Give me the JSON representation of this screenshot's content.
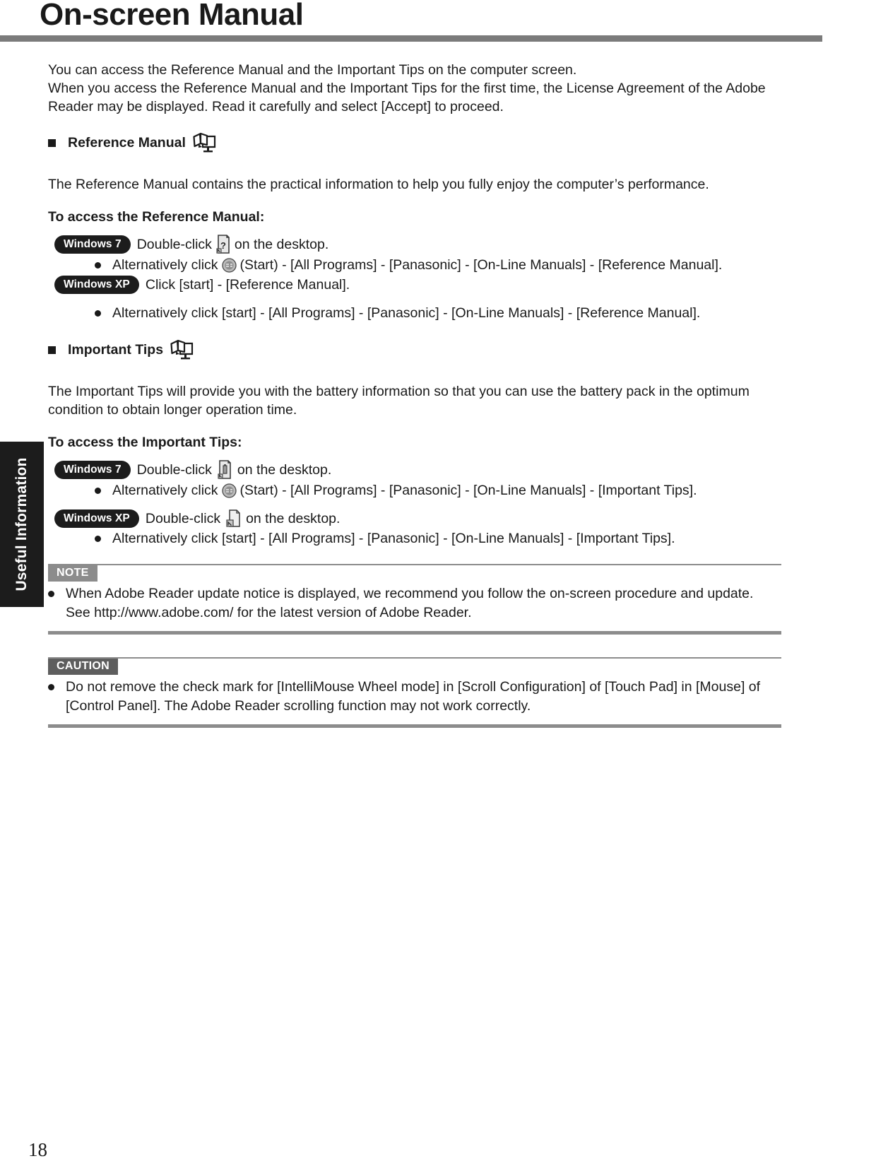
{
  "header": {
    "title": "On-screen Manual"
  },
  "side_tab": {
    "label": "Useful Information"
  },
  "intro": {
    "line1": "You can access the Reference Manual and the Important Tips on the computer screen.",
    "line2": "When you access the Reference Manual and the Important Tips for the first time, the License Agreement of the Adobe",
    "line3": "Reader may be displayed. Read it carefully and select [Accept] to proceed."
  },
  "reference_manual": {
    "heading": "Reference Manual",
    "heading_icon": "book-monitor-icon",
    "description": "The Reference Manual contains the practical information to help you fully enjoy the computer’s performance.",
    "access_heading": "To access the Reference Manual:",
    "win7_badge": "Windows 7",
    "win7_text_before": "Double-click",
    "win7_icon": "document-question-icon",
    "win7_text_after": "on the desktop.",
    "win7_alt_before": "Alternatively click",
    "win7_alt_icon": "start-orb-icon",
    "win7_alt_after": "(Start) - [All Programs] - [Panasonic] - [On-Line Manuals] - [Reference Manual].",
    "winxp_badge": "Windows XP",
    "winxp_text": "Click [start] - [Reference Manual].",
    "winxp_alt": "Alternatively click [start] - [All Programs] - [Panasonic] - [On-Line Manuals] - [Reference Manual]."
  },
  "important_tips": {
    "heading": "Important Tips",
    "heading_icon": "book-monitor-icon",
    "description_line1": "The Important Tips will provide you with the battery information so that you can use the battery pack in the optimum",
    "description_line2": "condition to obtain longer operation time.",
    "access_heading": "To access the Important Tips:",
    "win7_badge": "Windows 7",
    "win7_text_before": "Double-click",
    "win7_icon": "document-battery-icon",
    "win7_text_after": "on the desktop.",
    "win7_alt_before": "Alternatively click",
    "win7_alt_icon": "start-orb-icon",
    "win7_alt_after": "(Start) - [All Programs] - [Panasonic] - [On-Line Manuals] - [Important Tips].",
    "winxp_badge": "Windows XP",
    "winxp_text_before": "Double-click",
    "winxp_icon": "document-shortcut-icon",
    "winxp_text_after": "on the desktop.",
    "winxp_alt": "Alternatively click [start] - [All Programs] - [Panasonic] - [On-Line Manuals] - [Important Tips]."
  },
  "note": {
    "tag": "NOTE",
    "line1": "When Adobe Reader update notice is displayed, we recommend you follow the on-screen procedure and update.",
    "line2": "See http://www.adobe.com/ for the latest version of Adobe Reader."
  },
  "caution": {
    "tag": "CAUTION",
    "line1": "Do not remove the check mark for [IntelliMouse Wheel mode] in [Scroll Configuration] of [Touch Pad] in [Mouse] of",
    "line2": "[Control Panel]. The Adobe Reader scrolling function may not work correctly."
  },
  "footer": {
    "page_number": "18"
  },
  "colors": {
    "rule_gray": "#7b7b7b",
    "tag_gray": "#8c8c8c",
    "tag_dark": "#5e5e5e",
    "tab_black": "#1c1c1c",
    "text": "#1a1a1a"
  }
}
